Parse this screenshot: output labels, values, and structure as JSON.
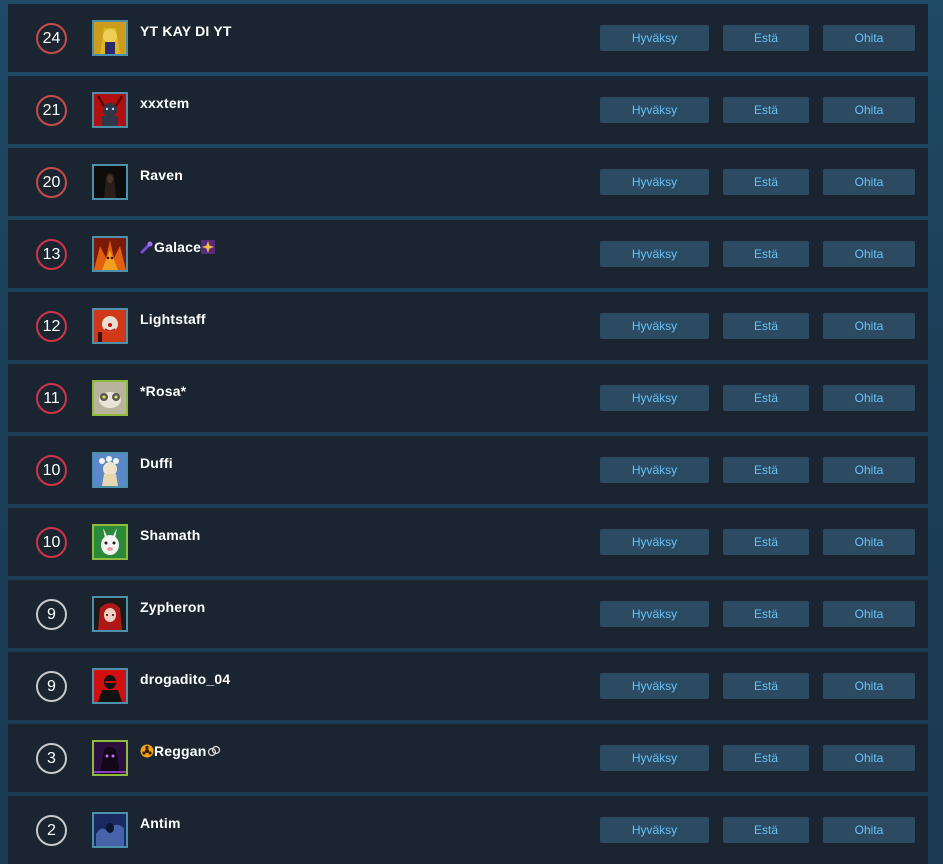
{
  "buttons": {
    "accept": "Hyväksy",
    "block": "Estä",
    "ignore": "Ohita"
  },
  "requests": [
    {
      "level": "24",
      "name": "YT KAY DI YT",
      "ring_color": "#c94a4a",
      "avatar_icon": "blonde-character-avatar",
      "avatar_border": "#4c91ac",
      "avatar_colors": [
        "#e8b010",
        "#2a2a6a"
      ]
    },
    {
      "level": "21",
      "name": "xxxtem",
      "ring_color": "#c94a4a",
      "avatar_icon": "red-demon-avatar",
      "avatar_border": "#4c91ac",
      "avatar_colors": [
        "#b01010",
        "#303848"
      ]
    },
    {
      "level": "20",
      "name": "Raven",
      "ring_color": "#c94a4a",
      "avatar_icon": "dark-hooded-avatar",
      "avatar_border": "#4c91ac",
      "avatar_colors": [
        "#0c0c0c",
        "#4a3428"
      ]
    },
    {
      "level": "13",
      "name": "Galace",
      "ring_color": "#d2334b",
      "avatar_icon": "fire-demon-avatar",
      "avatar_border": "#4c91ac",
      "avatar_colors": [
        "#e06010",
        "#7a1a08"
      ],
      "emoticon_before": "purple-comet-emoticon",
      "emoticon_after": "purple-sparkle-emoticon"
    },
    {
      "level": "12",
      "name": "Lightstaff",
      "ring_color": "#d2334b",
      "avatar_icon": "red-clown-avatar",
      "avatar_border": "#4c91ac",
      "avatar_colors": [
        "#d03818",
        "#e8e0d0"
      ]
    },
    {
      "level": "11",
      "name": "*Rosa*",
      "ring_color": "#d2334b",
      "avatar_icon": "lemur-avatar",
      "avatar_border": "#90ba3c",
      "avatar_colors": [
        "#b8b49c",
        "#5a5a50"
      ]
    },
    {
      "level": "10",
      "name": "Duffi",
      "ring_color": "#d2334b",
      "avatar_icon": "flower-girl-avatar",
      "avatar_border": "#4c91ac",
      "avatar_colors": [
        "#5a88c8",
        "#f0e4c8"
      ]
    },
    {
      "level": "10",
      "name": "Shamath",
      "ring_color": "#d2334b",
      "avatar_icon": "white-llama-avatar",
      "avatar_border": "#90ba3c",
      "avatar_colors": [
        "#2a8a3a",
        "#f4f4f4"
      ]
    },
    {
      "level": "9",
      "name": "Zypheron",
      "ring_color": "#c6c8ca",
      "avatar_icon": "red-hair-girl-avatar",
      "avatar_border": "#4c91ac",
      "avatar_colors": [
        "#b01818",
        "#1a1a1a"
      ]
    },
    {
      "level": "9",
      "name": "drogadito_04",
      "ring_color": "#c6c8ca",
      "avatar_icon": "masked-figure-avatar",
      "avatar_border": "#4c91ac",
      "avatar_colors": [
        "#d01010",
        "#111111"
      ]
    },
    {
      "level": "3",
      "name": "Reggan",
      "ring_color": "#c6c8ca",
      "avatar_icon": "purple-reaper-avatar",
      "avatar_border": "#90ba3c",
      "avatar_colors": [
        "#2a1040",
        "#8a40c0"
      ],
      "emoticon_before": "biohazard-emoticon",
      "emoticon_after": "skull-emoticon"
    },
    {
      "level": "2",
      "name": "Antim",
      "ring_color": "#c6c8ca",
      "avatar_icon": "blue-smoke-figure-avatar",
      "avatar_border": "#4c91ac",
      "avatar_colors": [
        "#1a2a60",
        "#5a7ac8"
      ]
    }
  ]
}
